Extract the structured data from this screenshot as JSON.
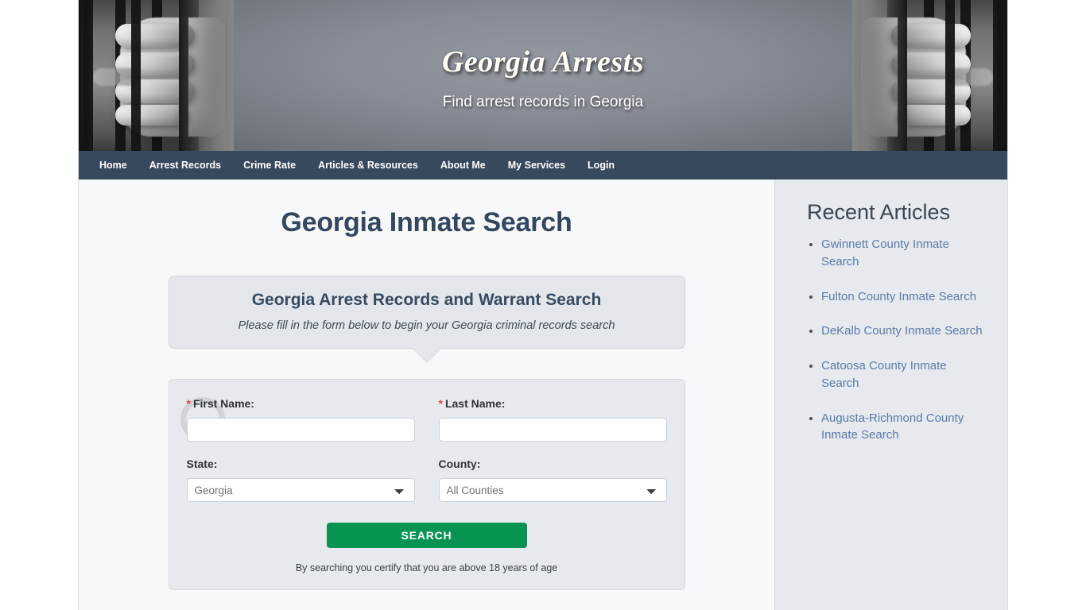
{
  "banner": {
    "site_title": "Georgia Arrests",
    "tagline": "Find arrest records in Georgia"
  },
  "nav": {
    "items": [
      {
        "label": "Home"
      },
      {
        "label": "Arrest Records"
      },
      {
        "label": "Crime Rate"
      },
      {
        "label": "Articles & Resources"
      },
      {
        "label": "About Me"
      },
      {
        "label": "My Services"
      },
      {
        "label": "Login"
      }
    ]
  },
  "main": {
    "page_title": "Georgia Inmate Search",
    "bubble": {
      "title": "Georgia Arrest Records and Warrant Search",
      "subtitle": "Please fill in the form below to begin your Georgia criminal records search"
    },
    "form": {
      "first_name": {
        "label": "First Name:",
        "required_marker": "*",
        "value": "",
        "placeholder": ""
      },
      "last_name": {
        "label": "Last Name:",
        "required_marker": "*",
        "value": "",
        "placeholder": ""
      },
      "state": {
        "label": "State:",
        "selected": "Georgia",
        "options": [
          "Georgia"
        ]
      },
      "county": {
        "label": "County:",
        "selected": "All Counties",
        "options": [
          "All Counties"
        ]
      },
      "submit_label": "SEARCH",
      "disclaimer": "By searching you certify that you are above 18 years of age"
    }
  },
  "sidebar": {
    "title": "Recent Articles",
    "articles": [
      {
        "label": "Gwinnett County Inmate Search"
      },
      {
        "label": "Fulton County Inmate Search"
      },
      {
        "label": "DeKalb County Inmate Search"
      },
      {
        "label": "Catoosa County Inmate Search"
      },
      {
        "label": "Augusta-Richmond County Inmate Search"
      }
    ]
  },
  "colors": {
    "nav_bg": "#1e2f47",
    "accent_green": "#089353",
    "heading": "#33475e",
    "link": "#5b7ba8",
    "required": "#e8423f"
  }
}
